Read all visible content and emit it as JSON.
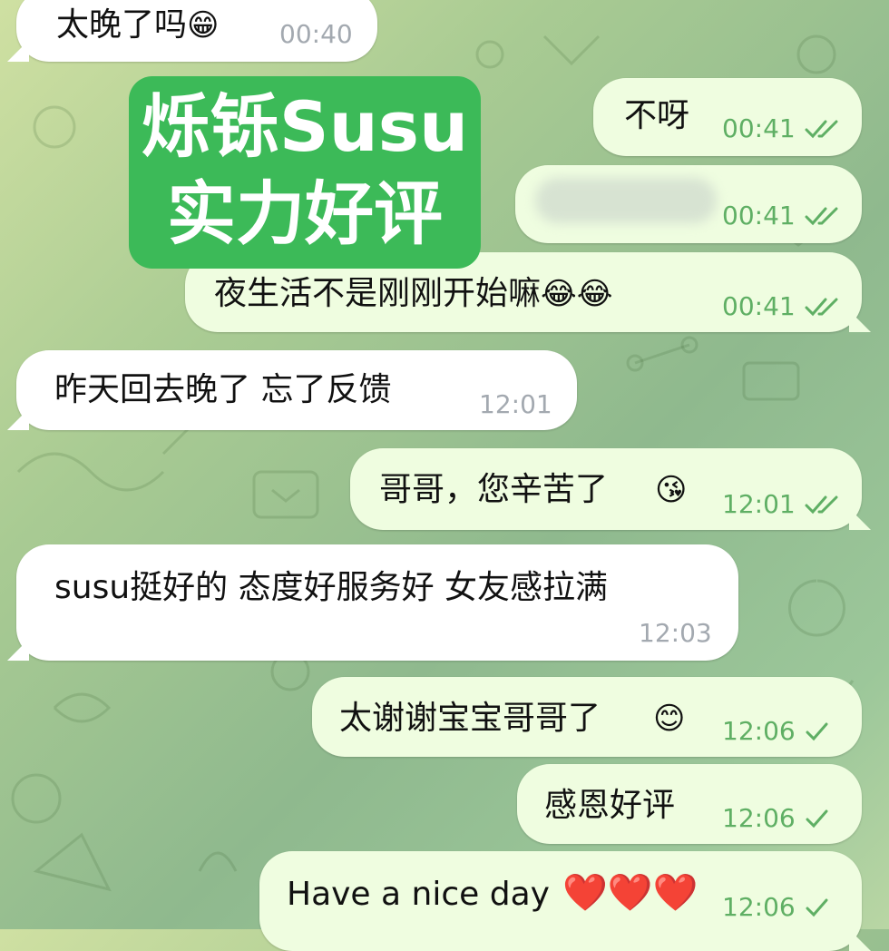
{
  "stamp": {
    "line1": "烁铄Susu",
    "line2": "实力好评"
  },
  "messages": [
    {
      "side": "in",
      "text": "太晚了吗",
      "emoji": "😁",
      "time": "00:40",
      "status": ""
    },
    {
      "side": "out",
      "text": "不呀",
      "emoji": "",
      "time": "00:41",
      "status": "read"
    },
    {
      "side": "out",
      "text": "",
      "emoji": "",
      "time": "00:41",
      "status": "read",
      "redacted": true
    },
    {
      "side": "out",
      "text": "夜生活不是刚刚开始嘛",
      "emoji": "😂😂",
      "time": "00:41",
      "status": "read"
    },
    {
      "side": "in",
      "text": "昨天回去晚了 忘了反馈",
      "emoji": "",
      "time": "12:01",
      "status": ""
    },
    {
      "side": "out",
      "text": "哥哥，您辛苦了",
      "emoji": "😘",
      "time": "12:01",
      "status": "read"
    },
    {
      "side": "in",
      "text": "susu挺好的 态度好服务好 女友感拉满",
      "emoji": "",
      "time": "12:03",
      "status": ""
    },
    {
      "side": "out",
      "text": "太谢谢宝宝哥哥了",
      "emoji": "😊",
      "time": "12:06",
      "status": "sent"
    },
    {
      "side": "out",
      "text": "感恩好评",
      "emoji": "",
      "time": "12:06",
      "status": "sent"
    },
    {
      "side": "out",
      "text": "Have a nice day",
      "emoji": "❤️❤️❤️",
      "time": "12:06",
      "status": "sent"
    }
  ],
  "colors": {
    "incoming": "#ffffff",
    "outgoing": "#effde0",
    "read_check": "#5faf64",
    "stamp": "#3cba58"
  }
}
